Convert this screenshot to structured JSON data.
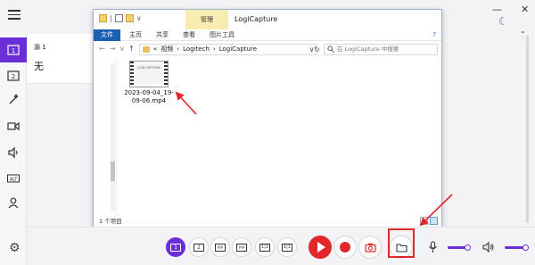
{
  "app": {
    "source_panel": {
      "source_name": "源 1",
      "source_value": "无"
    }
  },
  "explorer": {
    "manage_tab": "管理",
    "title": "LogiCapture",
    "ribbon_tabs": [
      "文件",
      "主页",
      "共享",
      "查看",
      "图片工具"
    ],
    "address": {
      "prefix": "«",
      "crumbs": [
        "视频",
        "Logitech",
        "LogiCapture"
      ]
    },
    "search_placeholder": "在 LogiCapture 中搜索",
    "files": [
      {
        "name": "2023-09-04_19-09-06.mp4",
        "thumb_label": "LOGI CAPTURE"
      }
    ],
    "status": "1 个项目"
  },
  "toolbar": {
    "layouts": [
      "1",
      "2",
      "PIP",
      "PIP",
      "1|2",
      "1|1"
    ],
    "icons": [
      "play-icon",
      "record-icon",
      "camera-icon",
      "folder-icon",
      "microphone-icon",
      "speaker-icon"
    ],
    "mic_level": 0.8,
    "speaker_level": 0.8
  },
  "colors": {
    "accent": "#6a2fd6",
    "record": "#e1272a",
    "explorer_blue": "#1a5fb4",
    "annotation": "#e1272a"
  }
}
